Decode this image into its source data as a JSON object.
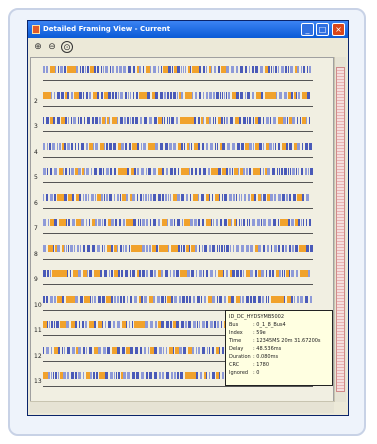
{
  "window": {
    "title": "Detailed Framing View - Current",
    "controls": {
      "minimize": "_",
      "maximize": "□",
      "close": "×"
    }
  },
  "toolbar": {
    "tools": [
      {
        "name": "zoom-in-icon",
        "glyph": "⊕"
      },
      {
        "name": "zoom-out-icon",
        "glyph": "⊖"
      },
      {
        "name": "zoom-fit-icon",
        "glyph": "⊙"
      }
    ]
  },
  "rows": [
    "",
    "2",
    "3",
    "4",
    "5",
    "6",
    "7",
    "8",
    "9",
    "10",
    "11",
    "12",
    "13"
  ],
  "tooltip": {
    "header": "ID_DC_HYDSYMB5002",
    "fields": [
      {
        "key": "Bus",
        "value": ": 0_1_8_Bus4"
      },
      {
        "key": "Index",
        "value": ": 59e"
      },
      {
        "key": "Time",
        "value": ": 12345MS 20m 31.67200s"
      },
      {
        "key": "Delay",
        "value": ": 48.536ms"
      },
      {
        "key": "Duration",
        "value": ": 0.080ms"
      },
      {
        "key": "CRC",
        "value": ": 1780"
      },
      {
        "key": "Ignored",
        "value": ": 0"
      }
    ]
  },
  "colors": {
    "frame_blue": "#4a5ab8",
    "frame_light": "#8e9ad8",
    "frame_orange": "#f1a22c",
    "tooltip_bg": "#ffffe1"
  }
}
